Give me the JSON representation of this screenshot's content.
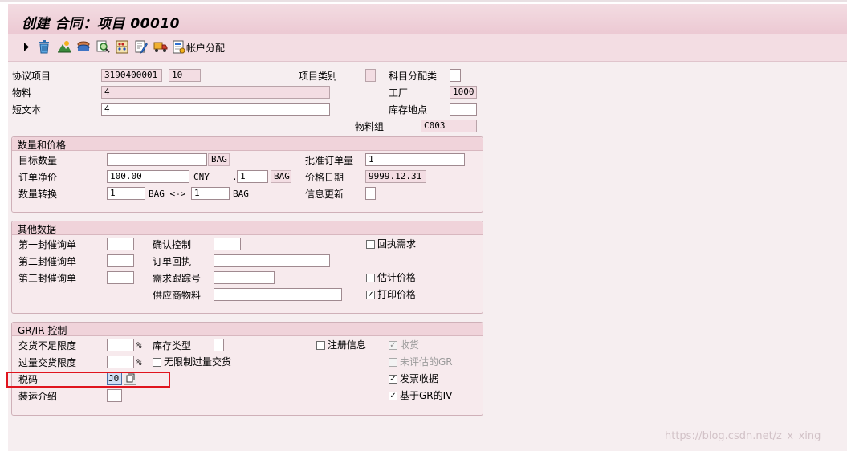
{
  "window": {
    "title": "创建 合同：项目 00010"
  },
  "toolbar": {
    "icons": [
      "play-icon",
      "trash-icon",
      "landscape-icon",
      "stack-icon",
      "magnifier-icon",
      "abacus-icon",
      "edit-icon",
      "truck-icon",
      "account-assign-icon"
    ],
    "account_assignment_label": "帐户分配"
  },
  "header": {
    "agreement_item_label": "协议项目",
    "agreement_number": "3190400001",
    "agreement_item": "10",
    "item_category_label": "项目类别",
    "item_category_value": "",
    "account_assignment_category_label": "科目分配类",
    "account_assignment_category_value": "",
    "material_label": "物料",
    "material_value": "4",
    "plant_label": "工厂",
    "plant_value": "1000",
    "short_text_label": "短文本",
    "short_text_value": "4",
    "storage_location_label": "库存地点",
    "storage_location_value": "",
    "material_group_label": "物料组",
    "material_group_value": "C003"
  },
  "quantity_price": {
    "title": "数量和价格",
    "target_qty_label": "目标数量",
    "target_qty_value": "",
    "target_qty_unit": "BAG",
    "order_price_unit_qty_label": "批准订单量",
    "order_price_unit_qty_value": "1",
    "net_price_label": "订单净价",
    "net_price_value": "100.00",
    "currency": "CNY",
    "per_separator": ".",
    "per_value": "1",
    "per_unit": "BAG",
    "price_date_label": "价格日期",
    "price_date_value": "9999.12.31",
    "conversion_label": "数量转换",
    "conversion_left_value": "1",
    "conversion_middle": "BAG <->",
    "conversion_right_value": "1",
    "conversion_right_unit": "BAG",
    "info_update_label": "信息更新",
    "info_update_value": ""
  },
  "other_data": {
    "title": "其他数据",
    "reminder1_label": "第一封催询单",
    "reminder1_value": "",
    "reminder2_label": "第二封催询单",
    "reminder2_value": "",
    "reminder3_label": "第三封催询单",
    "reminder3_value": "",
    "confirmation_control_label": "确认控制",
    "confirmation_control_value": "",
    "order_ack_label": "订单回执",
    "order_ack_value": "",
    "req_tracking_label": "需求跟踪号",
    "req_tracking_value": "",
    "vendor_material_label": "供应商物料",
    "vendor_material_value": "",
    "return_requirement_label": "回执需求",
    "return_requirement_checked": false,
    "estimated_price_label": "估计价格",
    "estimated_price_checked": false,
    "print_price_label": "打印价格",
    "print_price_checked": true
  },
  "grir_control": {
    "title": "GR/IR 控制",
    "underdelivery_label": "交货不足限度",
    "underdelivery_value": "",
    "overdelivery_label": "过量交货限度",
    "overdelivery_value": "",
    "percent": "%",
    "stock_type_label": "库存类型",
    "stock_type_value": "",
    "unlimited_overdelivery_label": "无限制过量交货",
    "unlimited_overdelivery_checked": false,
    "reg_info_label": "注册信息",
    "reg_info_checked": false,
    "goods_receipt_label": "收货",
    "goods_receipt_checked": true,
    "non_valuated_gr_label": "未评估的GR",
    "non_valuated_gr_checked": false,
    "invoice_receipt_label": "发票收据",
    "invoice_receipt_checked": true,
    "gr_based_iv_label": "基于GR的IV",
    "gr_based_iv_checked": true,
    "tax_code_label": "税码",
    "tax_code_value": "J0",
    "shipping_instr_label": "装运介绍",
    "shipping_instr_value": ""
  },
  "watermark": "https://blog.csdn.net/z_x_xing_",
  "colors": {
    "highlight": "#e0141e",
    "background": "#f6eef0",
    "header": "#f0d3da"
  }
}
